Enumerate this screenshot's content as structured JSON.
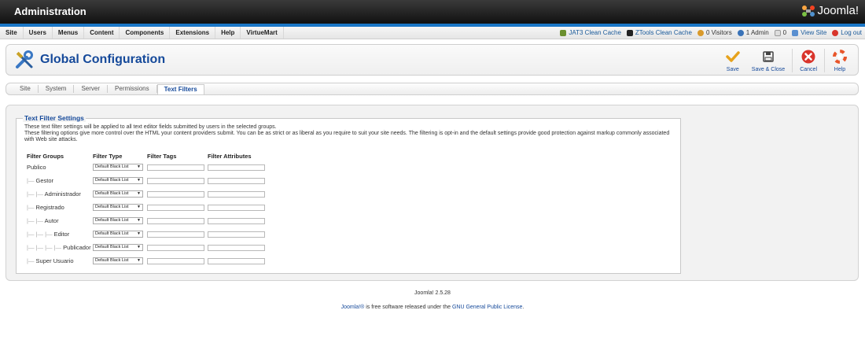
{
  "header": {
    "title": "Administration",
    "brand": "Joomla!"
  },
  "menu": {
    "items": [
      "Site",
      "Users",
      "Menus",
      "Content",
      "Components",
      "Extensions",
      "Help",
      "VirtueMart"
    ]
  },
  "status": {
    "jat3": "JAT3 Clean Cache",
    "ztools": "ZTools Clean Cache",
    "visitors": "0 Visitors",
    "admins": "1 Admin",
    "messages": "0",
    "view_site": "View Site",
    "logout": "Log out"
  },
  "toolbar": {
    "title": "Global Configuration",
    "save": "Save",
    "save_close": "Save & Close",
    "cancel": "Cancel",
    "help": "Help"
  },
  "tabs": [
    "Site",
    "System",
    "Server",
    "Permissions",
    "Text Filters"
  ],
  "filters": {
    "legend": "Text Filter Settings",
    "desc1": "These text filter settings will be applied to all text editor fields submitted by users in the selected groups.",
    "desc2": "These filtering options give more control over the HTML your content providers submit. You can be as strict or as liberal as you require to suit your site needs. The filtering is opt-in and the default settings provide good protection against markup commonly associated with Web site attacks.",
    "headers": {
      "groups": "Filter Groups",
      "type": "Filter Type",
      "tags": "Filter Tags",
      "attributes": "Filter Attributes"
    },
    "rows": [
      {
        "prefix": "",
        "name": "Publico",
        "type": "Default Black List"
      },
      {
        "prefix": "|—",
        "name": "Gestor",
        "type": "Default Black List"
      },
      {
        "prefix": "|— |—",
        "name": "Administrador",
        "type": "Default Black List"
      },
      {
        "prefix": "|—",
        "name": "Registrado",
        "type": "Default Black List"
      },
      {
        "prefix": "|— |—",
        "name": "Autor",
        "type": "Default Black List"
      },
      {
        "prefix": "|— |— |—",
        "name": "Editor",
        "type": "Default Black List"
      },
      {
        "prefix": "|— |— |— |—",
        "name": "Publicador",
        "type": "Default Black List"
      },
      {
        "prefix": "|—",
        "name": "Super Usuario",
        "type": "Default Black List"
      }
    ]
  },
  "footer": {
    "version": "Joomla! 2.5.28",
    "license_link1": "Joomla!®",
    "license_text": " is free software released under the ",
    "license_link2": "GNU General Public License",
    "license_end": "."
  },
  "colors": {
    "accent": "#15499a",
    "stripe": "#1a76c6"
  }
}
